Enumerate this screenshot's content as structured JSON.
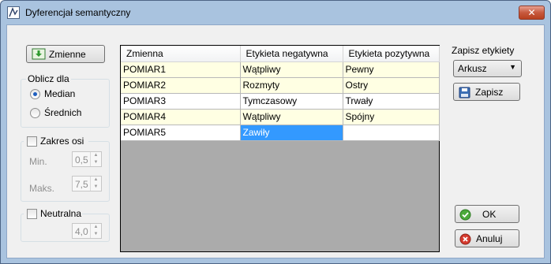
{
  "window": {
    "title": "Dyferencjał semantyczny",
    "close_glyph": "✕"
  },
  "toolbar": {
    "zmienne_label": "Zmienne"
  },
  "oblicz": {
    "caption": "Oblicz dla",
    "options": [
      {
        "label": "Median",
        "checked": true
      },
      {
        "label": "Średnich",
        "checked": false
      }
    ]
  },
  "zakres": {
    "caption": "Zakres osi",
    "min_label": "Min.",
    "min_value": "0,5",
    "max_label": "Maks.",
    "max_value": "7,5"
  },
  "neutralna": {
    "caption": "Neutralna",
    "value": "4,0"
  },
  "table": {
    "columns": [
      "Zmienna",
      "Etykieta negatywna",
      "Etykieta pozytywna"
    ],
    "rows": [
      [
        "POMIAR1",
        "Wątpliwy",
        "Pewny"
      ],
      [
        "POMIAR2",
        "Rozmyty",
        "Ostry"
      ],
      [
        "POMIAR3",
        "Tymczasowy",
        "Trwały"
      ],
      [
        "POMIAR4",
        "Wątpliwy",
        "Spójny"
      ],
      [
        "POMIAR5",
        "Zawiły",
        ""
      ]
    ]
  },
  "save": {
    "caption": "Zapisz etykiety",
    "target": "Arkusz",
    "save_label": "Zapisz"
  },
  "actions": {
    "ok_label": "OK",
    "cancel_label": "Anuluj"
  },
  "colors": {
    "row_alt": "#ffffe3",
    "selection": "#3399ff",
    "frame": "#a9c3df"
  }
}
